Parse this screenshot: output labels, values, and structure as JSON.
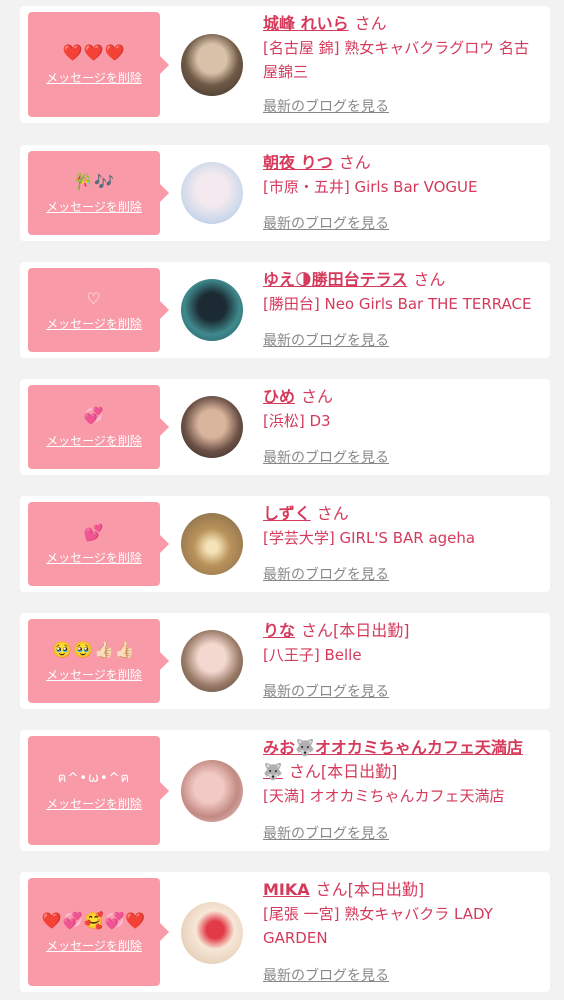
{
  "delete_label": "メッセージを削除",
  "blog_label": "最新のブログを見る",
  "san_label": "さん",
  "cards": [
    {
      "message": "❤️❤️❤️",
      "name": "城峰 れいら",
      "suffix": "さん",
      "shop": "[名古屋 錦] 熟女キャバクラグロウ 名古屋錦三"
    },
    {
      "message": "🎋🎶",
      "name": "朝夜 りつ",
      "suffix": "さん",
      "shop": "[市原・五井] Girls Bar VOGUE"
    },
    {
      "message": "♡",
      "name": "ゆえ🌗勝田台テラス",
      "suffix": "さん",
      "shop": "[勝田台] Neo Girls Bar THE TERRACE"
    },
    {
      "message": "💞",
      "name": "ひめ",
      "suffix": "さん",
      "shop": "[浜松] D3"
    },
    {
      "message": "💕",
      "name": "しずく",
      "suffix": "さん",
      "shop": "[学芸大学] GIRL'S BAR ageha"
    },
    {
      "message": "🥹🥹👍🏻👍🏻",
      "name": "りな",
      "suffix": "さん[本日出勤]",
      "shop": "[八王子] Belle"
    },
    {
      "message": "ฅ^•ω•^ฅ",
      "name": "みお🐺オオカミちゃんカフェ天満店🐺",
      "suffix": "さん[本日出勤]",
      "shop": "[天満] オオカミちゃんカフェ天満店"
    },
    {
      "message": "❤️💞🥰💞❤️",
      "name": "MIKA",
      "suffix": "さん[本日出勤]",
      "shop": "[尾張 一宮] 熟女キャバクラ LADY GARDEN"
    }
  ]
}
